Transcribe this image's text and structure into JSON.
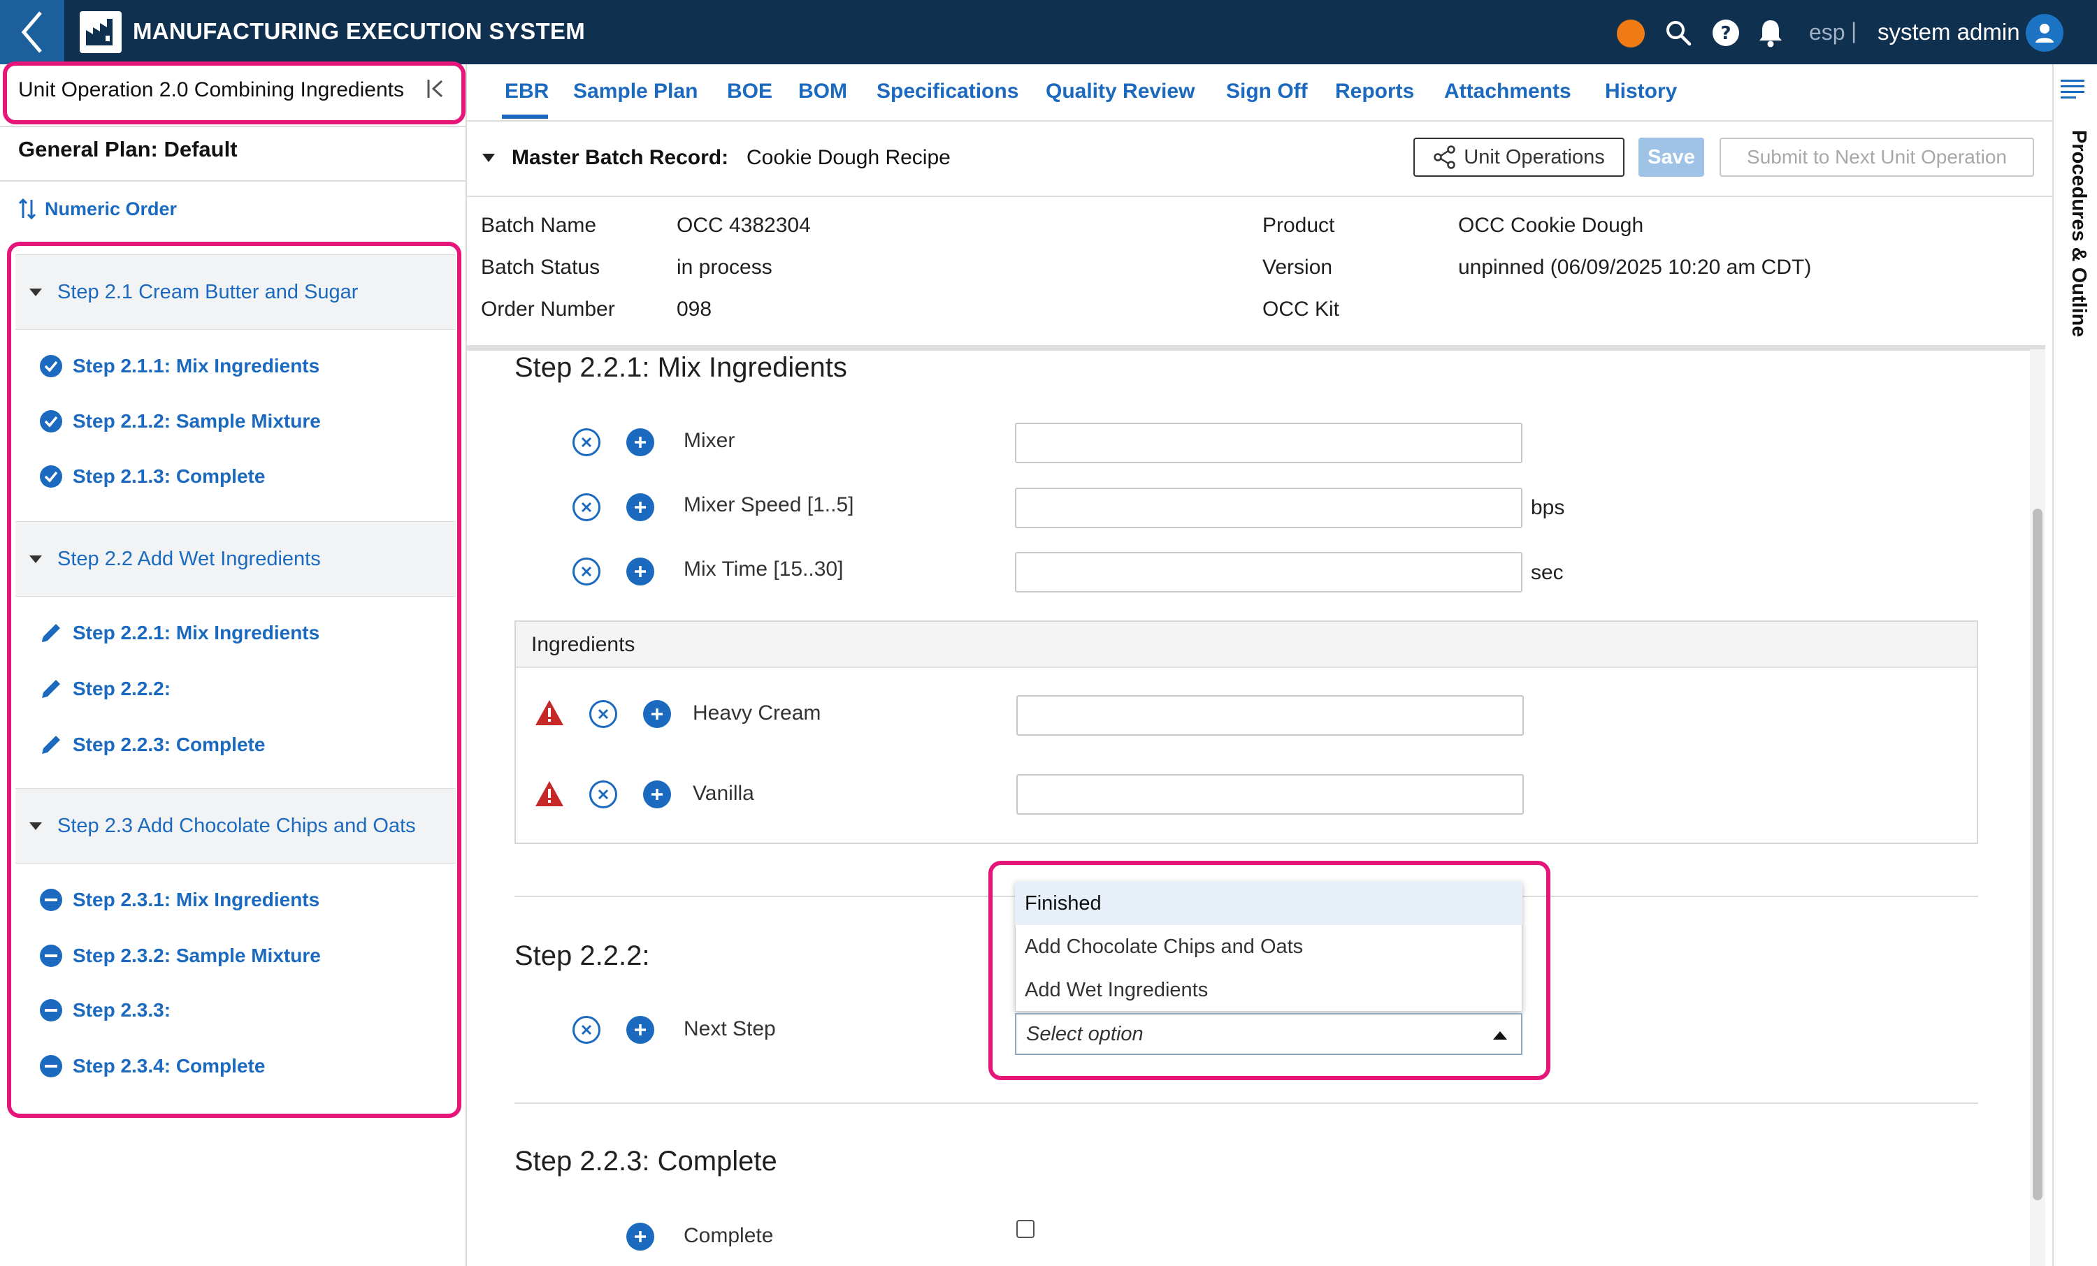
{
  "app": {
    "title": "MANUFACTURING EXECUTION SYSTEM",
    "lang": "esp",
    "lang_sep": "|",
    "user": "system admin",
    "colors": {
      "topbar": "#10304f",
      "accent": "#1b6ac0",
      "highlight": "#e6157a",
      "status_dot": "#f07b14"
    }
  },
  "left": {
    "unit_operation_title": "Unit Operation 2.0 Combining Ingredients",
    "plan_title": "General Plan: Default",
    "numeric_order": "Numeric Order",
    "groups": [
      {
        "label": "Step 2.1 Cream Butter and Sugar",
        "steps": [
          {
            "label": "Step 2.1.1: Mix Ingredients",
            "icon": "check-circle-icon"
          },
          {
            "label": "Step 2.1.2: Sample Mixture",
            "icon": "check-circle-icon"
          },
          {
            "label": "Step 2.1.3: Complete",
            "icon": "check-circle-icon"
          }
        ]
      },
      {
        "label": "Step 2.2 Add Wet Ingredients",
        "steps": [
          {
            "label": "Step 2.2.1: Mix Ingredients",
            "icon": "pencil-icon"
          },
          {
            "label": "Step 2.2.2:",
            "icon": "pencil-icon"
          },
          {
            "label": "Step 2.2.3: Complete",
            "icon": "pencil-icon"
          }
        ]
      },
      {
        "label": "Step 2.3 Add Chocolate Chips and Oats",
        "steps": [
          {
            "label": "Step 2.3.1: Mix Ingredients",
            "icon": "minus-circle-icon"
          },
          {
            "label": "Step 2.3.2: Sample Mixture",
            "icon": "minus-circle-icon"
          },
          {
            "label": "Step 2.3.3:",
            "icon": "minus-circle-icon"
          },
          {
            "label": "Step 2.3.4: Complete",
            "icon": "minus-circle-icon"
          }
        ]
      }
    ]
  },
  "tabs": [
    "EBR",
    "Sample Plan",
    "BOE",
    "BOM",
    "Specifications",
    "Quality Review",
    "Sign Off",
    "Reports",
    "Attachments",
    "History"
  ],
  "active_tab": "EBR",
  "header": {
    "mbr_label": "Master Batch Record:",
    "mbr_value": "Cookie Dough Recipe",
    "unit_operations_btn": "Unit Operations",
    "save_btn": "Save",
    "submit_btn": "Submit to Next Unit Operation"
  },
  "batch_info": {
    "left": [
      {
        "label": "Batch Name",
        "value": "OCC 4382304"
      },
      {
        "label": "Batch Status",
        "value": "in process"
      },
      {
        "label": "Order Number",
        "value": "098"
      }
    ],
    "right": [
      {
        "label": "Product",
        "value": "OCC Cookie Dough"
      },
      {
        "label": "Version",
        "value": "unpinned (06/09/2025 10:20 am CDT)"
      },
      {
        "label": "OCC Kit",
        "value": ""
      }
    ]
  },
  "right_rail": {
    "label": "Procedures & Outline"
  },
  "step221": {
    "title": "Step 2.2.1: Mix Ingredients",
    "fields": [
      {
        "label": "Mixer",
        "value": "",
        "unit": ""
      },
      {
        "label": "Mixer Speed [1..5]",
        "value": "",
        "unit": "bps"
      },
      {
        "label": "Mix Time [15..30]",
        "value": "",
        "unit": "sec"
      }
    ],
    "ingredients_title": "Ingredients",
    "ingredients": [
      {
        "label": "Heavy Cream",
        "value": ""
      },
      {
        "label": "Vanilla",
        "value": ""
      }
    ]
  },
  "step222": {
    "title": "Step 2.2.2:",
    "field_label": "Next Step",
    "dropdown": {
      "placeholder": "Select option",
      "options": [
        "Finished",
        "Add Chocolate Chips and Oats",
        "Add Wet Ingredients"
      ]
    }
  },
  "step223": {
    "title": "Step 2.2.3: Complete",
    "field_label": "Complete",
    "checked": false
  }
}
